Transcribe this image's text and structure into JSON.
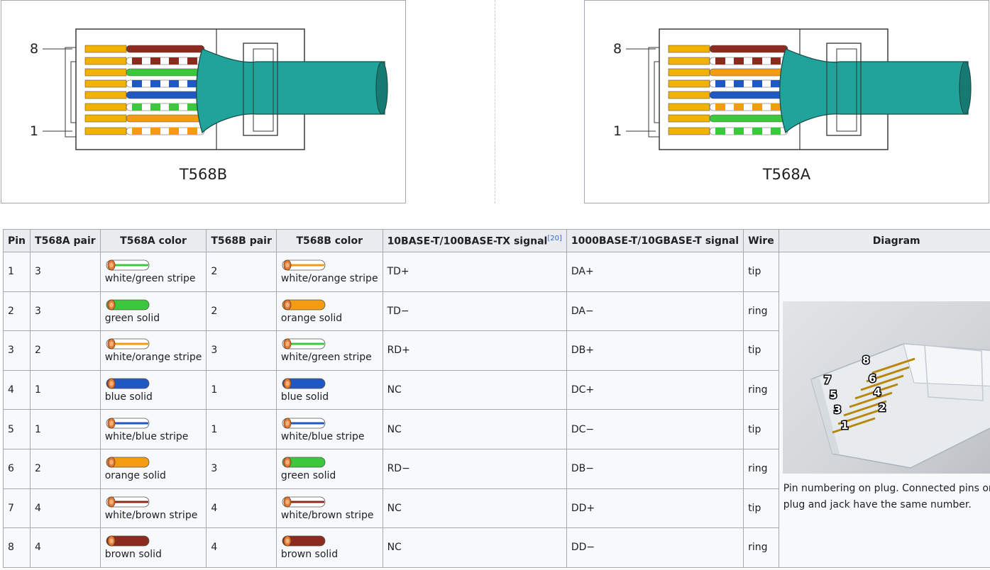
{
  "diagrams": [
    {
      "caption": "T568B",
      "pin_top": "8",
      "pin_bottom": "1",
      "wires": [
        "white/orange stripe",
        "orange solid",
        "white/green stripe",
        "blue solid",
        "white/blue stripe",
        "green solid",
        "white/brown stripe",
        "brown solid"
      ]
    },
    {
      "caption": "T568A",
      "pin_top": "8",
      "pin_bottom": "1",
      "wires": [
        "white/green stripe",
        "green solid",
        "white/orange stripe",
        "blue solid",
        "white/blue stripe",
        "orange solid",
        "white/brown stripe",
        "brown solid"
      ]
    }
  ],
  "colors": {
    "orange": "#f39c12",
    "green": "#3cc83c",
    "blue": "#1f57c3",
    "brown": "#8b2a1e",
    "cable": "#1fa39a",
    "header_bg": "#eaecf0",
    "cell_bg": "#f8f9fa",
    "border": "#a2a9b1"
  },
  "table": {
    "headers": [
      "Pin",
      "T568A pair",
      "T568A color",
      "T568B pair",
      "T568B color",
      "10BASE-T/100BASE-TX signal",
      "1000BASE-T/10GBASE-T signal",
      "Wire",
      "Diagram"
    ],
    "header_ref": "[20]",
    "rows": [
      {
        "pin": "1",
        "a_pair": "3",
        "a_color": "white/green stripe",
        "b_pair": "2",
        "b_color": "white/orange stripe",
        "sig100": "TD+",
        "sig1000": "DA+",
        "wire": "tip"
      },
      {
        "pin": "2",
        "a_pair": "3",
        "a_color": "green solid",
        "b_pair": "2",
        "b_color": "orange solid",
        "sig100": "TD−",
        "sig1000": "DA−",
        "wire": "ring"
      },
      {
        "pin": "3",
        "a_pair": "2",
        "a_color": "white/orange stripe",
        "b_pair": "3",
        "b_color": "white/green stripe",
        "sig100": "RD+",
        "sig1000": "DB+",
        "wire": "tip"
      },
      {
        "pin": "4",
        "a_pair": "1",
        "a_color": "blue solid",
        "b_pair": "1",
        "b_color": "blue solid",
        "sig100": "NC",
        "sig1000": "DC+",
        "wire": "ring"
      },
      {
        "pin": "5",
        "a_pair": "1",
        "a_color": "white/blue stripe",
        "b_pair": "1",
        "b_color": "white/blue stripe",
        "sig100": "NC",
        "sig1000": "DC−",
        "wire": "tip"
      },
      {
        "pin": "6",
        "a_pair": "2",
        "a_color": "orange solid",
        "b_pair": "3",
        "b_color": "green solid",
        "sig100": "RD−",
        "sig1000": "DB−",
        "wire": "ring"
      },
      {
        "pin": "7",
        "a_pair": "4",
        "a_color": "white/brown stripe",
        "b_pair": "4",
        "b_color": "white/brown stripe",
        "sig100": "NC",
        "sig1000": "DD+",
        "wire": "tip"
      },
      {
        "pin": "8",
        "a_pair": "4",
        "a_color": "brown solid",
        "b_pair": "4",
        "b_color": "brown solid",
        "sig100": "NC",
        "sig1000": "DD−",
        "wire": "ring"
      }
    ],
    "diagram_caption": "Pin numbering on plug. Connected pins on plug and jack have the same number.",
    "photo_pins": [
      "1",
      "2",
      "3",
      "4",
      "5",
      "6",
      "7",
      "8"
    ]
  }
}
